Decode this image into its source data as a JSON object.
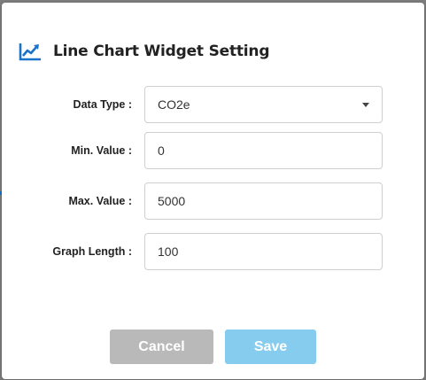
{
  "dialog": {
    "title": "Line Chart Widget Setting",
    "icon": "line-chart-icon"
  },
  "form": {
    "data_type": {
      "label": "Data Type :",
      "value": "CO2e"
    },
    "min_value": {
      "label": "Min. Value :",
      "value": "0"
    },
    "max_value": {
      "label": "Max. Value :",
      "value": "5000"
    },
    "graph_length": {
      "label": "Graph Length :",
      "value": "100"
    }
  },
  "buttons": {
    "cancel_label": "Cancel",
    "save_label": "Save"
  },
  "colors": {
    "accent": "#1a73c8",
    "cancel": "#b9b9b9",
    "save": "#86ccef"
  }
}
